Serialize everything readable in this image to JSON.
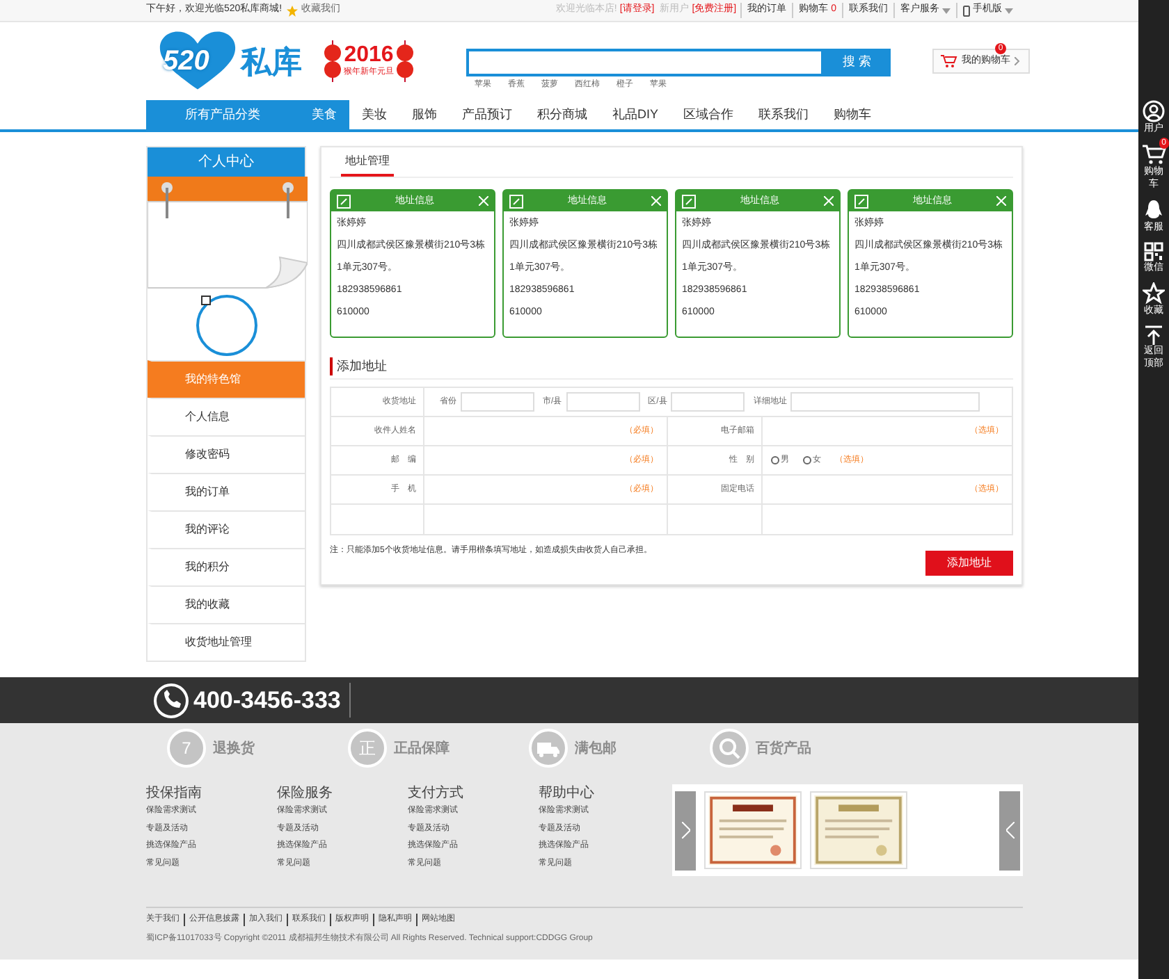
{
  "top_bar": {
    "greeting": "下午好，欢迎光临520私库商城!",
    "favorite": "收藏我们",
    "welcome": "欢迎光临本店!",
    "login": "[请登录]",
    "new_user": "新用户",
    "register": "[免费注册]",
    "links": [
      {
        "kind": "text",
        "label": "我的订单"
      },
      {
        "kind": "text",
        "label": "购物车",
        "badge": "0"
      },
      {
        "kind": "text",
        "label": "联系我们"
      },
      {
        "kind": "text",
        "label": "客户服务",
        "dropdown": true
      },
      {
        "kind": "phone",
        "label": "手机版",
        "dropdown": true
      }
    ]
  },
  "header": {
    "logo_number": "520",
    "logo_name": "私库",
    "banner_year": "2016",
    "banner_caption": "猴年新年元旦",
    "search": {
      "button": "搜 索"
    },
    "hot_words": [
      "苹果",
      "香蕉",
      "菠萝",
      "西红柿",
      "橙子",
      "苹果"
    ],
    "cart": {
      "label": "我的购物车",
      "badge": "0"
    }
  },
  "nav": {
    "category": "所有产品分类",
    "items": [
      {
        "label": "美食",
        "selected": true
      },
      {
        "label": "美妆",
        "selected": false
      },
      {
        "label": "服饰",
        "selected": false
      },
      {
        "label": "产品预订",
        "selected": false
      },
      {
        "label": "积分商城",
        "selected": false
      },
      {
        "label": "礼品DIY",
        "selected": false
      },
      {
        "label": "区域合作",
        "selected": false
      },
      {
        "label": "联系我们",
        "selected": false
      },
      {
        "label": "购物车",
        "selected": false
      }
    ]
  },
  "sidebar": {
    "title": "个人中心",
    "items": [
      {
        "label": "我的特色馆",
        "selected": true
      },
      {
        "label": "个人信息",
        "selected": false
      },
      {
        "label": "修改密码",
        "selected": false
      },
      {
        "label": "我的订单",
        "selected": false
      },
      {
        "label": "我的评论",
        "selected": false
      },
      {
        "label": "我的积分",
        "selected": false
      },
      {
        "label": "我的收藏",
        "selected": false
      },
      {
        "label": "收货地址管理",
        "selected": false
      }
    ]
  },
  "tabs": [
    {
      "label": "地址管理",
      "selected": true
    }
  ],
  "address_cards": [
    {
      "title": "地址信息",
      "name": "张婷婷",
      "address": "四川成都武侯区豫景横街210号3栋1单元307号。",
      "phone": "182938596861",
      "postcode": "610000"
    },
    {
      "title": "地址信息",
      "name": "张婷婷",
      "address": "四川成都武侯区豫景横街210号3栋1单元307号。",
      "phone": "182938596861",
      "postcode": "610000"
    },
    {
      "title": "地址信息",
      "name": "张婷婷",
      "address": "四川成都武侯区豫景横街210号3栋1单元307号。",
      "phone": "182938596861",
      "postcode": "610000"
    },
    {
      "title": "地址信息",
      "name": "张婷婷",
      "address": "四川成都武侯区豫景横街210号3栋1单元307号。",
      "phone": "182938596861",
      "postcode": "610000"
    }
  ],
  "add_form": {
    "title": "添加地址",
    "address_label": "收货地址",
    "address_fields": [
      {
        "label": "省份"
      },
      {
        "label": "市/县"
      },
      {
        "label": "区/县"
      },
      {
        "label": "详细地址"
      }
    ],
    "rows": [
      [
        {
          "kind": "text",
          "label": "收件人姓名",
          "hint": "（必填）"
        },
        {
          "kind": "text",
          "label": "电子邮箱",
          "hint": "（选填）"
        }
      ],
      [
        {
          "kind": "text",
          "label": "邮　编",
          "hint": "（必填）"
        },
        {
          "kind": "radio",
          "label": "性　别",
          "options": [
            {
              "label": "男",
              "selected": false
            },
            {
              "label": "女",
              "selected": false
            }
          ],
          "hint": "（选填）"
        }
      ],
      [
        {
          "kind": "text",
          "label": "手　机",
          "hint": "（必填）"
        },
        {
          "kind": "text",
          "label": "固定电话",
          "hint": "（选填）"
        }
      ]
    ],
    "note": "注：只能添加5个收货地址信息。请手用楷条填写地址，如造成损失由收货人自己承担。",
    "submit": "添加地址"
  },
  "hotline": "400-3456-333",
  "services": [
    {
      "kind": "badge",
      "badge": "7",
      "title": "退换货"
    },
    {
      "kind": "badge",
      "badge": "正",
      "title": "正品保障"
    },
    {
      "kind": "truck",
      "title": "满包邮"
    },
    {
      "kind": "search",
      "title": "百货产品"
    }
  ],
  "footer_columns": [
    {
      "title": "投保指南",
      "links": [
        "保险需求测试",
        "专题及活动",
        "挑选保险产品",
        "常见问题"
      ]
    },
    {
      "title": "保险服务",
      "links": [
        "保险需求测试",
        "专题及活动",
        "挑选保险产品",
        "常见问题"
      ]
    },
    {
      "title": "支付方式",
      "links": [
        "保险需求测试",
        "专题及活动",
        "挑选保险产品",
        "常见问题"
      ]
    },
    {
      "title": "帮助中心",
      "links": [
        "保险需求测试",
        "专题及活动",
        "挑选保险产品",
        "常见问题"
      ]
    }
  ],
  "certificates": [
    {
      "kind": "picture"
    },
    {
      "kind": "picture"
    }
  ],
  "footer_links": [
    "关于我们",
    "公开信息披露",
    "加入我们",
    "联系我们",
    "版权声明",
    "隐私声明",
    "网站地图"
  ],
  "copyright": "蜀ICP备11017033号 Copyright ©2011 成都福邦生物技术有限公司 All Rights Reserved. Technical support:CDDGG Group",
  "right_bar": [
    {
      "kind": "user",
      "label": "用户"
    },
    {
      "kind": "cart",
      "label": "购物车",
      "badge": "0"
    },
    {
      "kind": "chat",
      "label": "客服"
    },
    {
      "kind": "qr",
      "label": "微信"
    },
    {
      "kind": "star",
      "label": "收藏"
    },
    {
      "kind": "top",
      "label": "返回顶部"
    }
  ]
}
